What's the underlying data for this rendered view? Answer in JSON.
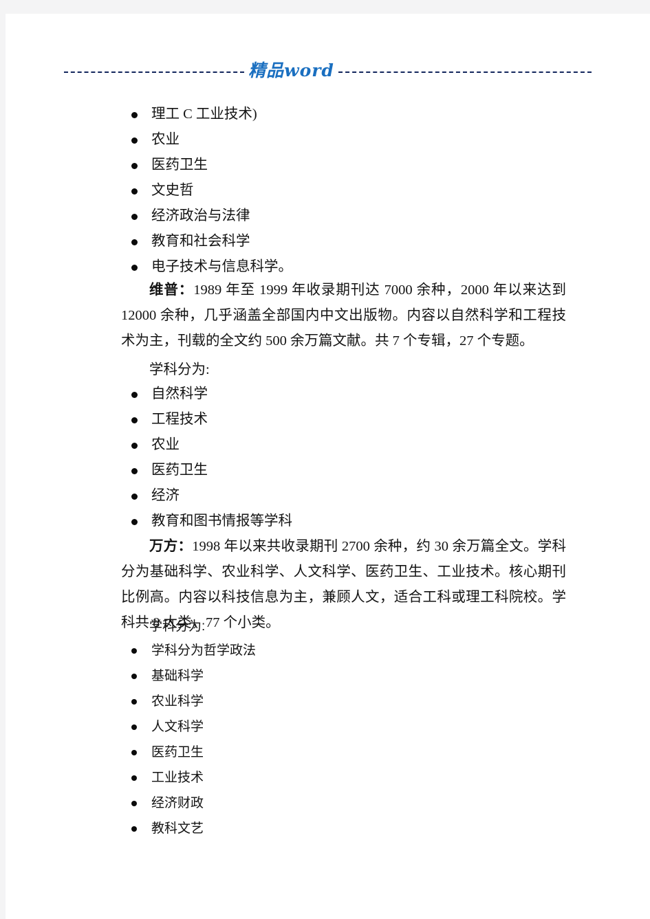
{
  "header": {
    "watermark_text": "精品word",
    "watermark_color": "#1a6fc0",
    "rule_color": "#12255c"
  },
  "page": {
    "background": "#ffffff",
    "canvas_background": "#f4f4f5",
    "text_color": "#141414"
  },
  "sections": [
    {
      "type": "list",
      "items": [
        "理工 C 工业技术)",
        "农业",
        "医药卫生",
        "文史哲",
        "经济政治与法律",
        "教育和社会科学",
        "电子技术与信息科学。"
      ]
    },
    {
      "type": "paragraph",
      "lead": "维普：",
      "body": "1989 年至 1999 年收录期刊达 7000 余种，2000 年以来达到 12000 余种，几乎涵盖全部国内中文出版物。内容以自然科学和工程技术为主，刊载的全文约 500 余万篇文献。共 7 个专辑，27 个专题。"
    },
    {
      "type": "plain",
      "text": "学科分为:"
    },
    {
      "type": "list",
      "items": [
        "自然科学",
        "工程技术",
        "农业",
        "医药卫生",
        "经济",
        "教育和图书情报等学科"
      ]
    },
    {
      "type": "paragraph",
      "lead": "万方：",
      "body": "1998 年以来共收录期刊 2700 余种，约 30 余万篇全文。学科分为基础科学、农业科学、人文科学、医药卫生、工业技术。核心期刊比例高。内容以科技信息为主，兼顾人文，适合工科或理工科院校。学科共 8 大类，77 个小类。"
    },
    {
      "type": "plain",
      "text": "学科分为:"
    },
    {
      "type": "list",
      "style": "hei",
      "items": [
        "学科分为哲学政法",
        "基础科学",
        "农业科学",
        "人文科学",
        "医药卫生",
        "工业技术",
        "经济财政",
        "教科文艺"
      ]
    }
  ]
}
